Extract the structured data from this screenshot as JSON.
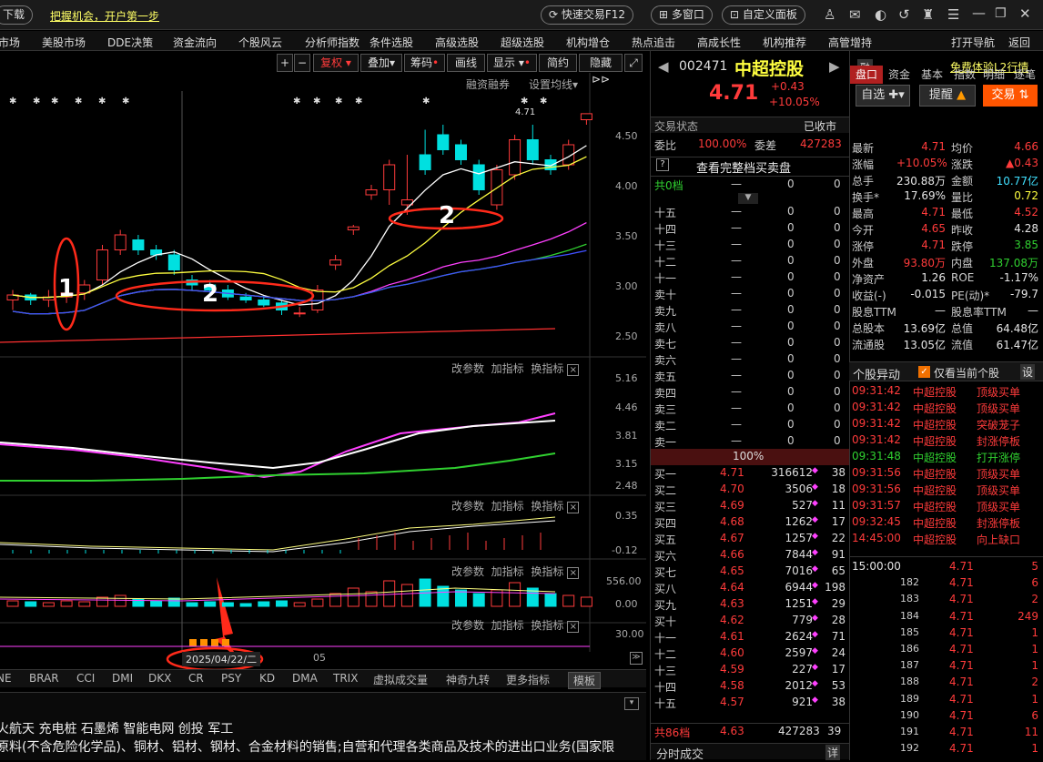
{
  "topbar": {
    "download": "下载",
    "slogan": "把握机会，开户第一步",
    "fast_trade": "快速交易F12",
    "multi_window": "多窗口",
    "custom_panel": "自定义面板"
  },
  "nav": [
    "市场",
    "美股市场",
    "DDE决策",
    "资金流向",
    "个股风云",
    "分析师指数",
    "条件选股",
    "高级选股",
    "超级选股",
    "机构增仓",
    "热点追击",
    "高成长性",
    "机构推荐",
    "高管增持",
    "打开导航",
    "返回"
  ],
  "toolbar": {
    "plus": "+",
    "minus": "−",
    "fuquan": "复权",
    "diejia": "叠加",
    "chouma": "筹码",
    "huaxian": "画线",
    "xianshi": "显示",
    "jianyue": "简约",
    "yincang": "隐藏"
  },
  "panel_main": {
    "rzrq": "融资融券",
    "ma_setting": "设置均线",
    "last_label": "4.71",
    "ylabels": [
      "4.50",
      "4.00",
      "3.50",
      "3.00",
      "2.50"
    ],
    "annot1": "1",
    "annot2a": "2",
    "annot2b": "2"
  },
  "panel_ind": {
    "gaicanshu": "改参数",
    "jiazhibiao": "加指标",
    "huanzhibiao": "换指标",
    "close": "×"
  },
  "panel2_ylabels": [
    "5.16",
    "4.46",
    "3.81",
    "3.15",
    "2.48"
  ],
  "panel3_ylabels": [
    "0.35",
    "-0.12"
  ],
  "panel4_ylabels": [
    "556.00",
    "0.00"
  ],
  "panel5_ylabels": [
    "30.00"
  ],
  "date_label": "2025/04/22/二",
  "month_label": "05",
  "ind_tabs": [
    "NE",
    "BRAR",
    "CCI",
    "DMI",
    "DKX",
    "CR",
    "PSY",
    "KD",
    "DMA",
    "TRIX",
    "虚拟成交量",
    "神奇九转",
    "更多指标",
    "模板"
  ],
  "bottom": {
    "tags": "火航天  充电桩  石墨烯  智能电网  创投  军工",
    "desc": "原料(不含危险化学品)、铜材、铝材、钢材、合金材料的销售;自营和代理各类商品及技术的进出口业务(国家限"
  },
  "stock": {
    "code": "002471",
    "name": "中超控股",
    "rong": "融",
    "l2": "免费体验L2行情",
    "price": "4.71",
    "change": "+0.43",
    "pct": "+10.05%",
    "zixuan": "自选",
    "tixing": "提醒",
    "jiaoyi": "交易"
  },
  "quote": {
    "status_label": "交易状态",
    "status": "已收市",
    "weibi_label": "委比",
    "weibi": "100.00%",
    "weicha_label": "委差",
    "weicha": "427283",
    "view_all": "查看完整档买卖盘",
    "q_mark": "?",
    "gong0": "共0档",
    "dash": "—",
    "zero": "0",
    "sell_levels": [
      "十五",
      "十四",
      "十三",
      "十二",
      "十一",
      "卖十",
      "卖九",
      "卖八",
      "卖七",
      "卖六",
      "卖五",
      "卖四",
      "卖三",
      "卖二",
      "卖一"
    ],
    "mid": "100%",
    "buys": [
      [
        "买一",
        "4.71",
        "316612",
        "38"
      ],
      [
        "买二",
        "4.70",
        "3506",
        "18"
      ],
      [
        "买三",
        "4.69",
        "527",
        "11"
      ],
      [
        "买四",
        "4.68",
        "1262",
        "17"
      ],
      [
        "买五",
        "4.67",
        "1257",
        "22"
      ],
      [
        "买六",
        "4.66",
        "7844",
        "91"
      ],
      [
        "买七",
        "4.65",
        "7016",
        "65"
      ],
      [
        "买八",
        "4.64",
        "6944",
        "198"
      ],
      [
        "买九",
        "4.63",
        "1251",
        "29"
      ],
      [
        "买十",
        "4.62",
        "779",
        "28"
      ],
      [
        "十一",
        "4.61",
        "2624",
        "71"
      ],
      [
        "十二",
        "4.60",
        "2597",
        "24"
      ],
      [
        "十三",
        "4.59",
        "227",
        "17"
      ],
      [
        "十四",
        "4.58",
        "2012",
        "53"
      ],
      [
        "十五",
        "4.57",
        "921",
        "38"
      ]
    ],
    "total_label": "共86档",
    "total_price": "4.63",
    "total_vol": "427283",
    "total_cnt": "39",
    "fenshi": "分时成交",
    "xiang": "详"
  },
  "right": {
    "tabs": [
      "盘口",
      "资金",
      "基本",
      "指数",
      "明细",
      "逐笔"
    ],
    "stats": [
      [
        "最新",
        "4.71",
        "均价",
        "4.66"
      ],
      [
        "涨幅",
        "+10.05%",
        "涨跌",
        "▲0.43"
      ],
      [
        "总手",
        "230.88万",
        "金额",
        "10.77亿"
      ],
      [
        "换手*",
        "17.69%",
        "量比",
        "0.72"
      ],
      [
        "最高",
        "4.71",
        "最低",
        "4.52"
      ],
      [
        "今开",
        "4.65",
        "昨收",
        "4.28"
      ],
      [
        "涨停",
        "4.71",
        "跌停",
        "3.85"
      ],
      [
        "外盘",
        "93.80万",
        "内盘",
        "137.08万"
      ],
      [
        "净资产",
        "1.26",
        "ROE",
        "-1.17%"
      ],
      [
        "收益(-)",
        "-0.015",
        "PE(动)*",
        "-79.7"
      ],
      [
        "股息TTM",
        "—",
        "股息率TTM",
        "—"
      ],
      [
        "总股本",
        "13.69亿",
        "总值",
        "64.48亿"
      ],
      [
        "流通股",
        "13.05亿",
        "流值",
        "61.47亿"
      ]
    ],
    "yidong_title": "个股异动",
    "only_current": "仅看当前个股",
    "she": "设",
    "yidong": [
      [
        "09:31:42",
        "中超控股",
        "顶级买单"
      ],
      [
        "09:31:42",
        "中超控股",
        "顶级买单"
      ],
      [
        "09:31:42",
        "中超控股",
        "突破茏子"
      ],
      [
        "09:31:42",
        "中超控股",
        "封涨停板"
      ],
      [
        "09:31:48",
        "中超控股",
        "打开涨停"
      ],
      [
        "09:31:56",
        "中超控股",
        "顶级买单"
      ],
      [
        "09:31:56",
        "中超控股",
        "顶级买单"
      ],
      [
        "09:31:57",
        "中超控股",
        "顶级买单"
      ],
      [
        "09:32:45",
        "中超控股",
        "封涨停板"
      ],
      [
        "14:45:00",
        "中超控股",
        "向上缺口"
      ]
    ],
    "ticks": [
      [
        "15:00:00",
        "4.71",
        "5"
      ],
      [
        "182",
        "4.71",
        "6"
      ],
      [
        "183",
        "4.71",
        "2"
      ],
      [
        "184",
        "4.71",
        "249"
      ],
      [
        "185",
        "4.71",
        "1"
      ],
      [
        "186",
        "4.71",
        "1"
      ],
      [
        "187",
        "4.71",
        "1"
      ],
      [
        "188",
        "4.71",
        "2"
      ],
      [
        "189",
        "4.71",
        "1"
      ],
      [
        "190",
        "4.71",
        "6"
      ],
      [
        "191",
        "4.71",
        "11"
      ],
      [
        "192",
        "4.71",
        "1"
      ]
    ]
  },
  "chart_data": {
    "type": "candlestick",
    "candles": [
      [
        2.85,
        2.95,
        2.75,
        2.9
      ],
      [
        2.9,
        2.92,
        2.8,
        2.85
      ],
      [
        2.85,
        2.95,
        2.78,
        2.88
      ],
      [
        2.88,
        3.0,
        2.82,
        2.92
      ],
      [
        2.92,
        3.05,
        2.85,
        3.0
      ],
      [
        3.05,
        3.4,
        3.0,
        3.35
      ],
      [
        3.35,
        3.55,
        3.3,
        3.5
      ],
      [
        3.45,
        3.5,
        3.3,
        3.35
      ],
      [
        3.35,
        3.4,
        3.25,
        3.3
      ],
      [
        3.3,
        3.35,
        3.1,
        3.15
      ],
      [
        3.05,
        3.1,
        2.95,
        3.0
      ],
      [
        3.0,
        3.05,
        2.92,
        2.95
      ],
      [
        2.95,
        3.0,
        2.85,
        2.88
      ],
      [
        2.88,
        2.92,
        2.82,
        2.85
      ],
      [
        2.85,
        2.9,
        2.78,
        2.8
      ],
      [
        2.82,
        2.85,
        2.7,
        2.75
      ],
      [
        2.72,
        2.78,
        2.68,
        2.72
      ],
      [
        2.75,
        3.0,
        2.72,
        2.95
      ],
      [
        3.2,
        3.3,
        3.15,
        3.25
      ],
      [
        3.55,
        3.6,
        3.5,
        3.58
      ],
      [
        3.9,
        4.0,
        3.85,
        3.95
      ],
      [
        3.95,
        4.25,
        3.8,
        4.2
      ],
      [
        3.8,
        4.3,
        3.7,
        3.85
      ],
      [
        4.3,
        4.55,
        4.1,
        4.15
      ],
      [
        4.5,
        4.6,
        4.3,
        4.35
      ],
      [
        4.4,
        4.45,
        4.2,
        4.25
      ],
      [
        4.2,
        4.25,
        3.9,
        3.95
      ],
      [
        3.8,
        4.2,
        3.75,
        4.15
      ],
      [
        4.1,
        4.5,
        4.05,
        4.45
      ],
      [
        4.45,
        4.6,
        4.2,
        4.25
      ],
      [
        4.25,
        4.3,
        4.1,
        4.15
      ],
      [
        4.2,
        4.45,
        4.15,
        4.4
      ],
      [
        4.65,
        4.71,
        4.6,
        4.71
      ]
    ]
  }
}
